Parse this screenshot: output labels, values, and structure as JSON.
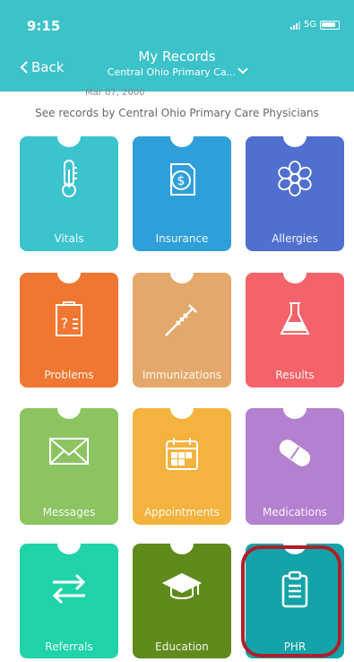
{
  "status": {
    "time": "9:15",
    "network": "5G"
  },
  "nav": {
    "back_label": "Back",
    "title": "My Records",
    "subtitle": "Central Ohio Primary Ca..."
  },
  "cut_date": "Mar 07, 2000",
  "caption": "See records by Central Ohio Primary Care Physicians",
  "tiles": [
    {
      "label": "Vitals",
      "color": "#3bc3ce",
      "icon": "thermometer-icon"
    },
    {
      "label": "Insurance",
      "color": "#2f9fda",
      "icon": "dollar-document-icon"
    },
    {
      "label": "Allergies",
      "color": "#5070cf",
      "icon": "flower-icon"
    },
    {
      "label": "Problems",
      "color": "#f07732",
      "icon": "clipboard-question-icon"
    },
    {
      "label": "Immunizations",
      "color": "#e3a86a",
      "icon": "syringe-icon"
    },
    {
      "label": "Results",
      "color": "#f4636a",
      "icon": "flask-icon"
    },
    {
      "label": "Messages",
      "color": "#8dc462",
      "icon": "envelope-icon"
    },
    {
      "label": "Appointments",
      "color": "#f3b33e",
      "icon": "calendar-icon"
    },
    {
      "label": "Medications",
      "color": "#b480d0",
      "icon": "pill-icon"
    },
    {
      "label": "Referrals",
      "color": "#20d3a9",
      "icon": "swap-arrows-icon"
    },
    {
      "label": "Education",
      "color": "#5f8a1c",
      "icon": "graduation-cap-icon"
    },
    {
      "label": "PHR",
      "color": "#13a3a8",
      "icon": "clipboard-list-icon"
    }
  ]
}
